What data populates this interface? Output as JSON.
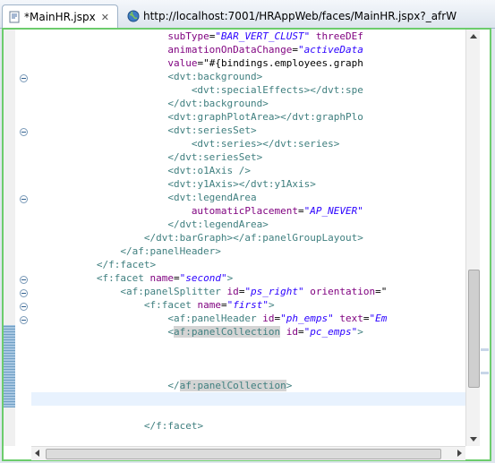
{
  "tabs": [
    {
      "label": "*MainHR.jspx",
      "icon": "jspx-file-icon",
      "close": "✕"
    },
    {
      "label": "http://localhost:7001/HRAppWeb/faces/MainHR.jspx?_afrW",
      "icon": "globe-icon"
    }
  ],
  "code": {
    "lines": [
      [
        {
          "t": "                       ",
          "c": "plain"
        },
        {
          "t": "subType",
          "c": "attr"
        },
        {
          "t": "=",
          "c": "plain"
        },
        {
          "t": "\"BAR_VERT_CLUST\"",
          "c": "val"
        },
        {
          "t": " threeDEf",
          "c": "attr"
        }
      ],
      [
        {
          "t": "                       ",
          "c": "plain"
        },
        {
          "t": "animationOnDataChange",
          "c": "attr"
        },
        {
          "t": "=",
          "c": "plain"
        },
        {
          "t": "\"activeData",
          "c": "val"
        }
      ],
      [
        {
          "t": "                       ",
          "c": "plain"
        },
        {
          "t": "value",
          "c": "attr"
        },
        {
          "t": "=\"#{bindings.employees.graph",
          "c": "plain"
        }
      ],
      [
        {
          "t": "                       ",
          "c": "plain"
        },
        {
          "t": "<dvt:background>",
          "c": "tag"
        }
      ],
      [
        {
          "t": "                           ",
          "c": "plain"
        },
        {
          "t": "<dvt:specialEffects></dvt:spe",
          "c": "tag"
        }
      ],
      [
        {
          "t": "                       ",
          "c": "plain"
        },
        {
          "t": "</dvt:background>",
          "c": "tag"
        }
      ],
      [
        {
          "t": "                       ",
          "c": "plain"
        },
        {
          "t": "<dvt:graphPlotArea></dvt:graphPlo",
          "c": "tag"
        }
      ],
      [
        {
          "t": "                       ",
          "c": "plain"
        },
        {
          "t": "<dvt:seriesSet>",
          "c": "tag"
        }
      ],
      [
        {
          "t": "                           ",
          "c": "plain"
        },
        {
          "t": "<dvt:series></dvt:series>",
          "c": "tag"
        }
      ],
      [
        {
          "t": "                       ",
          "c": "plain"
        },
        {
          "t": "</dvt:seriesSet>",
          "c": "tag"
        }
      ],
      [
        {
          "t": "                       ",
          "c": "plain"
        },
        {
          "t": "<dvt:o1Axis />",
          "c": "tag"
        }
      ],
      [
        {
          "t": "                       ",
          "c": "plain"
        },
        {
          "t": "<dvt:y1Axis></dvt:y1Axis>",
          "c": "tag"
        }
      ],
      [
        {
          "t": "                       ",
          "c": "plain"
        },
        {
          "t": "<dvt:legendArea",
          "c": "tag"
        }
      ],
      [
        {
          "t": "                           ",
          "c": "plain"
        },
        {
          "t": "automaticPlacement",
          "c": "attr"
        },
        {
          "t": "=",
          "c": "plain"
        },
        {
          "t": "\"AP_NEVER\"",
          "c": "val"
        }
      ],
      [
        {
          "t": "                       ",
          "c": "plain"
        },
        {
          "t": "</dvt:legendArea>",
          "c": "tag"
        }
      ],
      [
        {
          "t": "                   ",
          "c": "plain"
        },
        {
          "t": "</dvt:barGraph></af:panelGroupLayout>",
          "c": "tag"
        }
      ],
      [
        {
          "t": "               ",
          "c": "plain"
        },
        {
          "t": "</af:panelHeader>",
          "c": "tag"
        }
      ],
      [
        {
          "t": "           ",
          "c": "plain"
        },
        {
          "t": "</f:facet>",
          "c": "tag"
        }
      ],
      [
        {
          "t": "           ",
          "c": "plain"
        },
        {
          "t": "<f:facet",
          "c": "tag"
        },
        {
          "t": " name",
          "c": "attr"
        },
        {
          "t": "=",
          "c": "plain"
        },
        {
          "t": "\"second\"",
          "c": "val"
        },
        {
          "t": ">",
          "c": "tag"
        }
      ],
      [
        {
          "t": "               ",
          "c": "plain"
        },
        {
          "t": "<af:panelSplitter",
          "c": "tag"
        },
        {
          "t": " id",
          "c": "attr"
        },
        {
          "t": "=",
          "c": "plain"
        },
        {
          "t": "\"ps_right\"",
          "c": "val"
        },
        {
          "t": " orientation",
          "c": "attr"
        },
        {
          "t": "=\"",
          "c": "plain"
        }
      ],
      [
        {
          "t": "                   ",
          "c": "plain"
        },
        {
          "t": "<f:facet",
          "c": "tag"
        },
        {
          "t": " name",
          "c": "attr"
        },
        {
          "t": "=",
          "c": "plain"
        },
        {
          "t": "\"first\"",
          "c": "val"
        },
        {
          "t": ">",
          "c": "tag"
        }
      ],
      [
        {
          "t": "                       ",
          "c": "plain"
        },
        {
          "t": "<af:panelHeader",
          "c": "tag"
        },
        {
          "t": " id",
          "c": "attr"
        },
        {
          "t": "=",
          "c": "plain"
        },
        {
          "t": "\"ph_emps\"",
          "c": "val"
        },
        {
          "t": " text",
          "c": "attr"
        },
        {
          "t": "=",
          "c": "plain"
        },
        {
          "t": "\"Em",
          "c": "val"
        }
      ],
      [
        {
          "t": "                       ",
          "c": "plain"
        },
        {
          "t": "<",
          "c": "tag"
        },
        {
          "t": "af:panelCollection",
          "c": "tag sel"
        },
        {
          "t": " id",
          "c": "attr"
        },
        {
          "t": "=",
          "c": "plain"
        },
        {
          "t": "\"pc_emps\"",
          "c": "val"
        },
        {
          "t": ">",
          "c": "tag"
        }
      ],
      [],
      [],
      [],
      [
        {
          "t": "                       ",
          "c": "plain"
        },
        {
          "t": "</",
          "c": "tag"
        },
        {
          "t": "af:panelCollection",
          "c": "tag sel"
        },
        {
          "t": ">",
          "c": "tag"
        }
      ],
      [],
      [],
      [
        {
          "t": "                   ",
          "c": "plain"
        },
        {
          "t": "</f:facet>",
          "c": "tag"
        }
      ]
    ]
  },
  "colors": {
    "editor_border": "#6ccc6c",
    "tag": "#3f7f7f",
    "attr": "#7f007f",
    "value": "#2a00ff",
    "current_line": "#e8f2fe"
  }
}
